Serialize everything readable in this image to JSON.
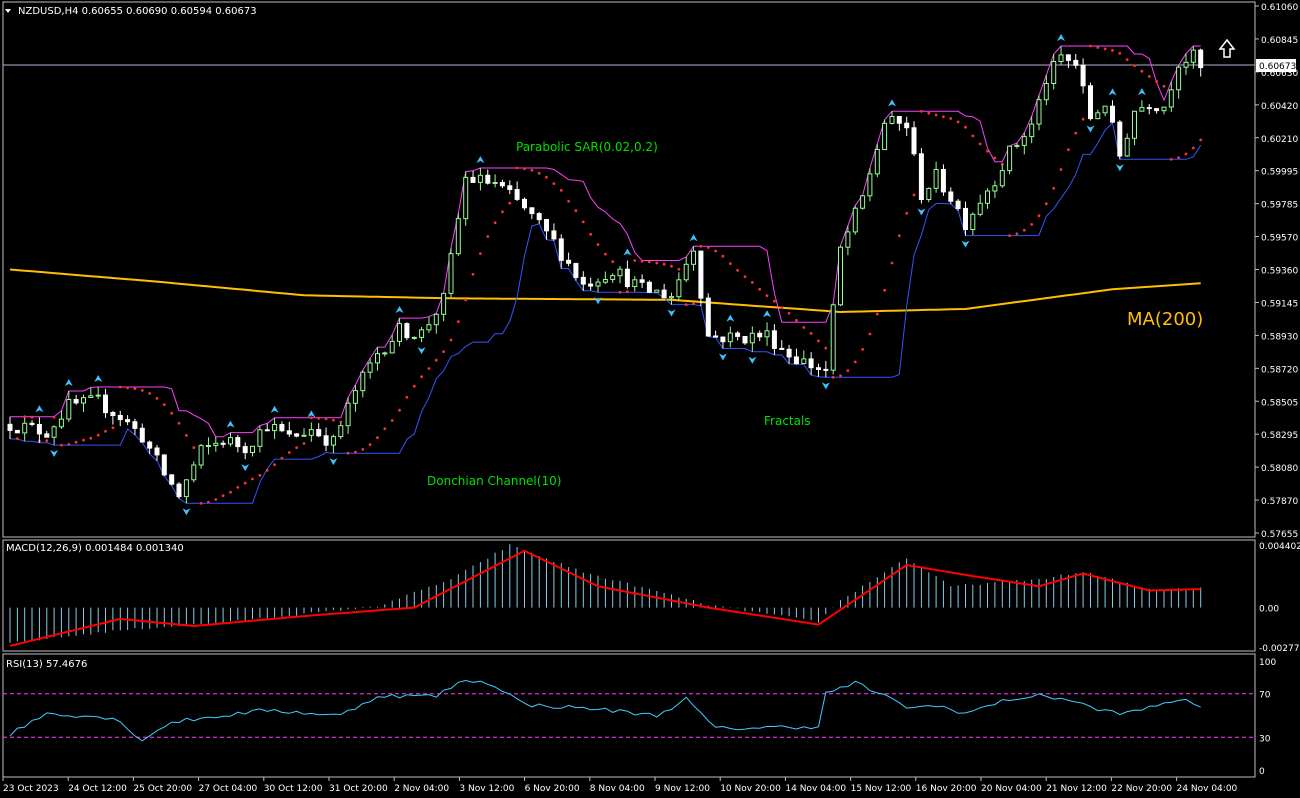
{
  "main_panel": {
    "header": "NZDUSD,H4  0.60655 0.60690 0.60594 0.60673",
    "price_ticks": [
      "0.61060",
      "0.60845",
      "0.60630",
      "0.60420",
      "0.60210",
      "0.59995",
      "0.59785",
      "0.59570",
      "0.59360",
      "0.59145",
      "0.58930",
      "0.58720",
      "0.58505",
      "0.58295",
      "0.58080",
      "0.57870",
      "0.57655"
    ],
    "current_price": "0.60673",
    "annotations": {
      "psar": "Parabolic SAR(0.02,0.2)",
      "donchian": "Donchian Channel(10)",
      "fractals": "Fractals",
      "ma": "MA(200)"
    },
    "arrow_icon": "up-arrow-icon"
  },
  "macd_panel": {
    "header": "MACD(12,26,9) 0.001484 0.001340",
    "ticks": [
      "0.004402",
      "0.00",
      "-0.002778"
    ]
  },
  "rsi_panel": {
    "header": "RSI(13) 57.4676",
    "ticks": [
      "100",
      "70",
      "30",
      "0"
    ]
  },
  "time_axis": [
    "23 Oct 2023",
    "24 Oct 12:00",
    "25 Oct 20:00",
    "27 Oct 04:00",
    "30 Oct 12:00",
    "31 Oct 20:00",
    "2 Nov 04:00",
    "3 Nov 12:00",
    "6 Nov 20:00",
    "8 Nov 04:00",
    "9 Nov 12:00",
    "10 Nov 20:00",
    "14 Nov 04:00",
    "15 Nov 12:00",
    "16 Nov 20:00",
    "20 Nov 04:00",
    "21 Nov 12:00",
    "22 Nov 20:00",
    "24 Nov 04:00"
  ],
  "colors": {
    "background": "#000000",
    "grid": "#c0c0c0",
    "bull": "#98fb98",
    "bear": "#ffffff",
    "sar": "#ff3030",
    "donchian_upper": "#ff40ff",
    "donchian_lower": "#3355ff",
    "ma": "#ffc000",
    "macd_hist": "#87ceeb",
    "macd_signal": "#ff0000",
    "rsi": "#40d0ff",
    "rsi_levels": "#ff40ff",
    "fractal": "#40c0ff",
    "annotation_green": "#00e000",
    "annotation_ma": "#ffc000"
  },
  "chart_data": {
    "type": "candlestick",
    "symbol": "NZDUSD",
    "timeframe": "H4",
    "y_range": [
      0.5762,
      0.6108
    ],
    "close_path": [
      [
        0,
        0.5833
      ],
      [
        5,
        0.5828
      ],
      [
        8,
        0.5845
      ],
      [
        12,
        0.5848
      ],
      [
        15,
        0.5838
      ],
      [
        18,
        0.5825
      ],
      [
        21,
        0.58
      ],
      [
        23,
        0.5786
      ],
      [
        26,
        0.5815
      ],
      [
        29,
        0.5823
      ],
      [
        32,
        0.5818
      ],
      [
        35,
        0.5833
      ],
      [
        38,
        0.5824
      ],
      [
        41,
        0.583
      ],
      [
        44,
        0.5821
      ],
      [
        47,
        0.5855
      ],
      [
        50,
        0.588
      ],
      [
        53,
        0.5895
      ],
      [
        56,
        0.5893
      ],
      [
        59,
        0.5915
      ],
      [
        62,
        0.5995
      ],
      [
        66,
        0.5992
      ],
      [
        70,
        0.5975
      ],
      [
        74,
        0.5953
      ],
      [
        78,
        0.5925
      ],
      [
        82,
        0.5935
      ],
      [
        86,
        0.5922
      ],
      [
        90,
        0.5918
      ],
      [
        93,
        0.595
      ],
      [
        95,
        0.5891
      ],
      [
        99,
        0.589
      ],
      [
        103,
        0.5892
      ],
      [
        106,
        0.5879
      ],
      [
        109,
        0.5872
      ],
      [
        111,
        0.5868
      ],
      [
        113,
        0.5948
      ],
      [
        116,
        0.5982
      ],
      [
        119,
        0.6032
      ],
      [
        122,
        0.603
      ],
      [
        124,
        0.5985
      ],
      [
        126,
        0.5996
      ],
      [
        128,
        0.5983
      ],
      [
        130,
        0.5966
      ],
      [
        132,
        0.5981
      ],
      [
        134,
        0.5995
      ],
      [
        136,
        0.6012
      ],
      [
        139,
        0.603
      ],
      [
        141,
        0.606
      ],
      [
        143,
        0.6075
      ],
      [
        145,
        0.607
      ],
      [
        147,
        0.6035
      ],
      [
        149,
        0.6045
      ],
      [
        151,
        0.601
      ],
      [
        153,
        0.604
      ],
      [
        155,
        0.6045
      ],
      [
        157,
        0.6043
      ],
      [
        159,
        0.6072
      ],
      [
        161,
        0.6075
      ],
      [
        162,
        0.6067
      ]
    ],
    "ma200_path": [
      [
        0,
        0.5935
      ],
      [
        20,
        0.5927
      ],
      [
        40,
        0.5918
      ],
      [
        60,
        0.5916
      ],
      [
        90,
        0.5915
      ],
      [
        113,
        0.5907
      ],
      [
        130,
        0.5909
      ],
      [
        150,
        0.5922
      ],
      [
        162,
        0.5926
      ]
    ],
    "macd_histogram_path": [
      [
        0,
        -0.0025
      ],
      [
        15,
        -0.0016
      ],
      [
        30,
        -0.001
      ],
      [
        50,
        0.0001
      ],
      [
        60,
        0.002
      ],
      [
        68,
        0.0044
      ],
      [
        78,
        0.0025
      ],
      [
        95,
        0.0002
      ],
      [
        110,
        -0.001
      ],
      [
        113,
        0.0005
      ],
      [
        122,
        0.0035
      ],
      [
        128,
        0.0015
      ],
      [
        140,
        0.002
      ],
      [
        146,
        0.0025
      ],
      [
        155,
        0.0013
      ],
      [
        162,
        0.0014
      ]
    ],
    "macd_signal_path": [
      [
        0,
        -0.0027
      ],
      [
        15,
        -0.0008
      ],
      [
        25,
        -0.0013
      ],
      [
        40,
        -0.0006
      ],
      [
        55,
        0.0
      ],
      [
        70,
        0.004
      ],
      [
        80,
        0.0015
      ],
      [
        95,
        0.0
      ],
      [
        110,
        -0.0012
      ],
      [
        122,
        0.003
      ],
      [
        130,
        0.0023
      ],
      [
        140,
        0.0015
      ],
      [
        146,
        0.0024
      ],
      [
        155,
        0.0012
      ],
      [
        162,
        0.0013
      ]
    ],
    "rsi_path": [
      [
        0,
        33
      ],
      [
        5,
        52
      ],
      [
        14,
        48
      ],
      [
        18,
        28
      ],
      [
        22,
        44
      ],
      [
        35,
        55
      ],
      [
        45,
        50
      ],
      [
        50,
        68
      ],
      [
        58,
        68
      ],
      [
        62,
        83
      ],
      [
        66,
        78
      ],
      [
        70,
        60
      ],
      [
        80,
        56
      ],
      [
        88,
        50
      ],
      [
        92,
        65
      ],
      [
        96,
        38
      ],
      [
        110,
        40
      ],
      [
        111,
        70
      ],
      [
        115,
        80
      ],
      [
        117,
        74
      ],
      [
        122,
        58
      ],
      [
        127,
        58
      ],
      [
        130,
        52
      ],
      [
        136,
        65
      ],
      [
        140,
        68
      ],
      [
        144,
        65
      ],
      [
        148,
        55
      ],
      [
        152,
        52
      ],
      [
        160,
        66
      ],
      [
        162,
        57
      ]
    ],
    "rsi_levels": [
      30,
      70
    ]
  }
}
